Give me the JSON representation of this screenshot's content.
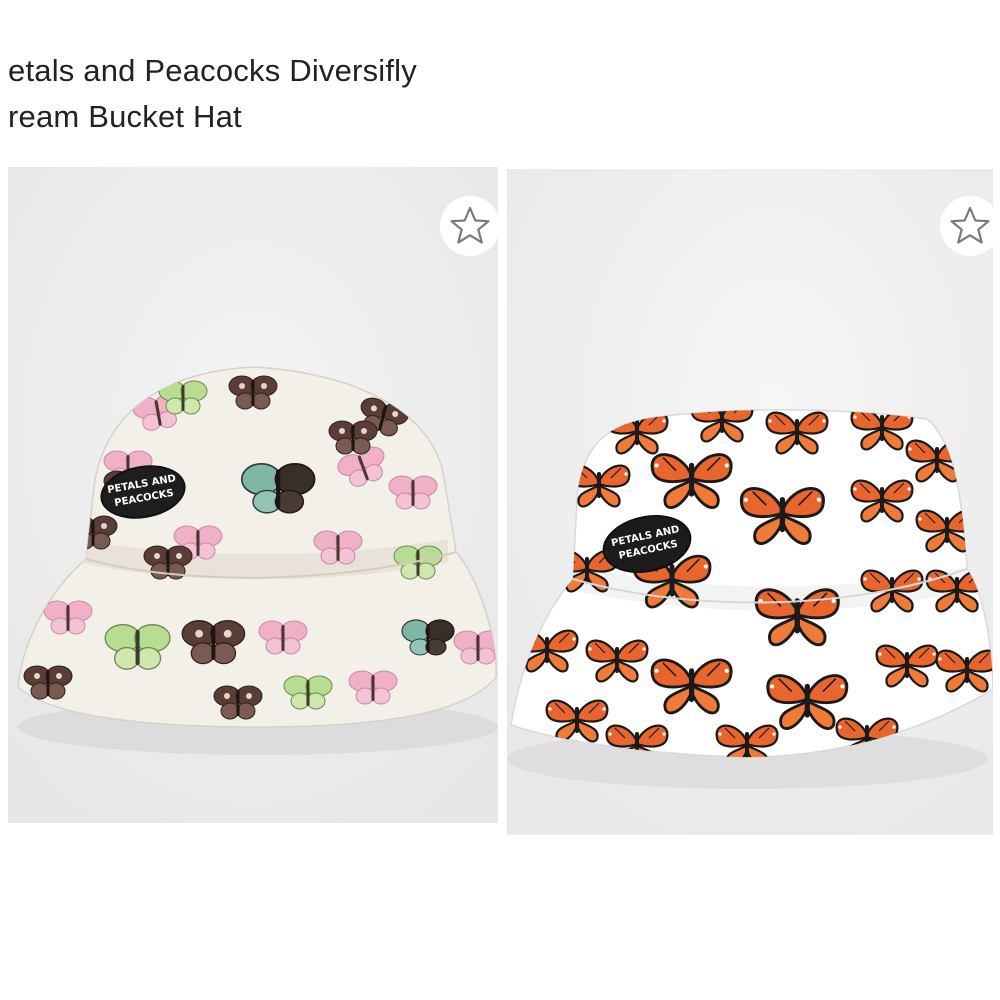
{
  "product": {
    "title_line1": "etals and Peacocks Diversifly",
    "title_line2": "ream Bucket Hat"
  },
  "images": [
    {
      "description": "Cream bucket hat with pink, green and brown butterfly print",
      "patch_text": [
        "PETALS AND",
        "PEACOCKS"
      ],
      "favorite_icon": "star-outline-icon"
    },
    {
      "description": "White bucket hat with orange monarch butterfly print",
      "patch_text": [
        "PETALS AND",
        "PEACOCKS"
      ],
      "favorite_icon": "star-outline-icon"
    }
  ],
  "colors": {
    "background": "#ffffff",
    "text": "#222222",
    "left_backdrop": "#efefef",
    "right_backdrop": "#f1f1f1",
    "left_hat": "#f3efe9",
    "right_hat": "#ffffff",
    "monarch_orange": "#e8662e",
    "pink_butterfly": "#efb0c8",
    "green_butterfly": "#b9dc93",
    "brown_butterfly": "#5a3d36",
    "star_outline": "#7a7a7a"
  }
}
